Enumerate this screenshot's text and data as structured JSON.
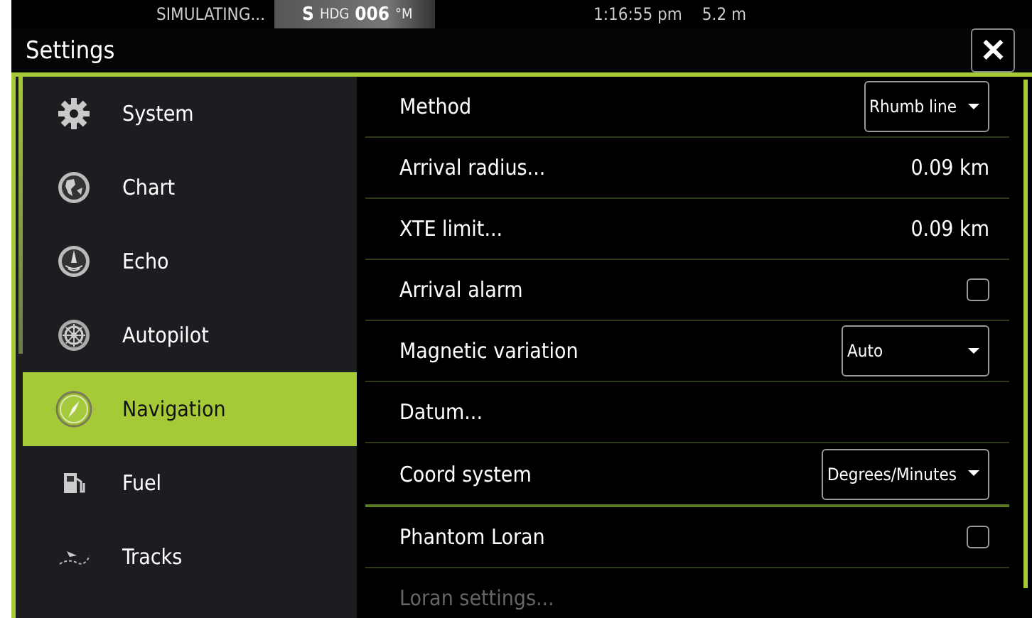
{
  "status_bar": {
    "mode": "SIMULATING...",
    "heading_prefix": "S",
    "heading_label": "HDG",
    "heading_value": "006",
    "heading_unit": "°M",
    "time": "1:16:55 pm",
    "depth": "5.2 m"
  },
  "window": {
    "title": "Settings",
    "close": "✕"
  },
  "sidebar": {
    "items": [
      {
        "label": "System",
        "selected": false
      },
      {
        "label": "Chart",
        "selected": false
      },
      {
        "label": "Echo",
        "selected": false
      },
      {
        "label": "Autopilot",
        "selected": false
      },
      {
        "label": "Navigation",
        "selected": true
      },
      {
        "label": "Fuel",
        "selected": false
      },
      {
        "label": "Tracks",
        "selected": false
      }
    ]
  },
  "settings": [
    {
      "kind": "dropdown",
      "label": "Method",
      "value": "Rhumb line",
      "section_end": false
    },
    {
      "kind": "value",
      "label": "Arrival radius...",
      "value": "0.09 km",
      "section_end": false
    },
    {
      "kind": "value",
      "label": "XTE limit...",
      "value": "0.09 km",
      "section_end": false
    },
    {
      "kind": "checkbox",
      "label": "Arrival alarm",
      "checked": false,
      "section_end": false
    },
    {
      "kind": "dropdown",
      "label": "Magnetic variation",
      "value": "Auto",
      "section_end": false
    },
    {
      "kind": "link",
      "label": "Datum...",
      "section_end": false
    },
    {
      "kind": "dropdown",
      "label": "Coord system",
      "value": "Degrees/Minutes",
      "section_end": true
    },
    {
      "kind": "checkbox",
      "label": "Phantom Loran",
      "checked": false,
      "section_end": false
    },
    {
      "kind": "link",
      "label": "Loran settings...",
      "disabled": true,
      "section_end": false
    }
  ]
}
